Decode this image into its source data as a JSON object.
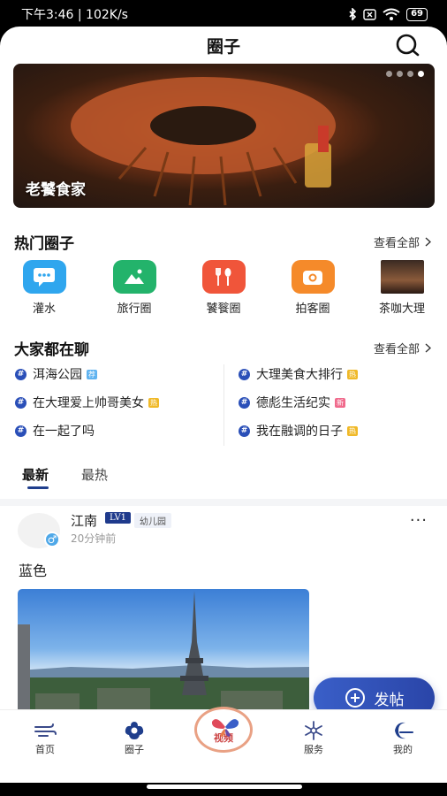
{
  "status_bar": {
    "time_speed": "下午3:46 | 102K/s",
    "battery": "69"
  },
  "header": {
    "title": "圈子"
  },
  "banner": {
    "caption": "老饕食家"
  },
  "hot_circles": {
    "title": "热门圈子",
    "see_all": "查看全部",
    "items": [
      {
        "label": "灌水",
        "icon": "chat-bubble-icon",
        "color": "#2fa6ee"
      },
      {
        "label": "旅行圈",
        "icon": "mountain-photo-icon",
        "color": "#23b36b"
      },
      {
        "label": "饕餮圈",
        "icon": "fork-spoon-icon",
        "color": "#f0553a"
      },
      {
        "label": "拍客圈",
        "icon": "camera-icon",
        "color": "#f58a2a"
      },
      {
        "label": "茶咖大理",
        "icon": "thumbnail-image",
        "color": "#6b4a3a"
      }
    ]
  },
  "chatting": {
    "title": "大家都在聊",
    "see_all": "查看全部",
    "topics": [
      {
        "text": "洱海公园",
        "tag": "荐",
        "tag_type": "jian"
      },
      {
        "text": "大理美食大排行",
        "tag": "热",
        "tag_type": "re"
      },
      {
        "text": "在大理爱上帅哥美女",
        "tag": "热",
        "tag_type": "re"
      },
      {
        "text": "德彪生活纪实",
        "tag": "新",
        "tag_type": "xin"
      },
      {
        "text": "在一起了吗",
        "tag": "",
        "tag_type": ""
      },
      {
        "text": "我在融调的日子",
        "tag": "热",
        "tag_type": "re"
      }
    ]
  },
  "feed_tabs": {
    "latest": "最新",
    "hottest": "最热"
  },
  "post": {
    "username": "江南",
    "level": "LV1",
    "rank": "幼儿园",
    "time": "20分钟前",
    "text": "蓝色",
    "more": "···"
  },
  "fab": {
    "label": "发帖"
  },
  "tabbar": {
    "home": "首页",
    "circle": "圈子",
    "center": "视频",
    "service": "服务",
    "mine": "我的"
  },
  "colors": {
    "primary": "#1f3e8c",
    "accent": "#3a5fc8"
  }
}
